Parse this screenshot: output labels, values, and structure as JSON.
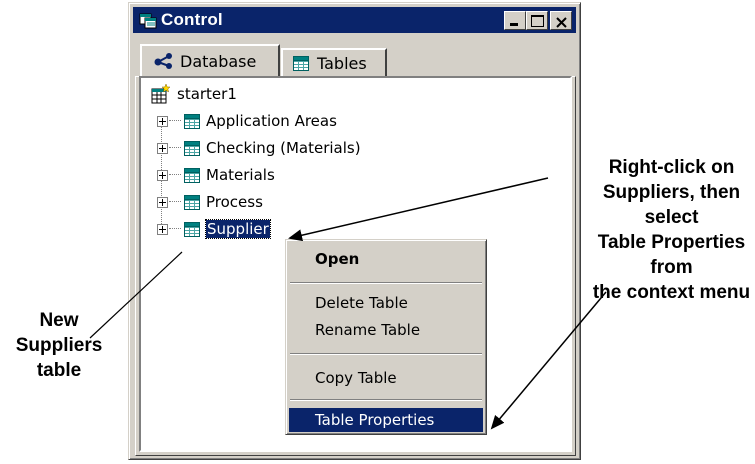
{
  "window": {
    "title": "Control",
    "title_icon": "control-window-icon"
  },
  "tabs": [
    {
      "label": "Database",
      "icon": "database-connection-icon",
      "selected": true
    },
    {
      "label": "Tables",
      "icon": "table-icon",
      "selected": false
    }
  ],
  "tree": {
    "root": {
      "label": "starter1",
      "icon": "new-database-icon"
    },
    "items": [
      {
        "label": "Application Areas",
        "icon": "table-icon"
      },
      {
        "label": "Checking (Materials)",
        "icon": "table-icon"
      },
      {
        "label": "Materials",
        "icon": "table-icon"
      },
      {
        "label": "Process",
        "icon": "table-icon"
      },
      {
        "label": "Supplier",
        "icon": "table-icon",
        "selected": true
      }
    ]
  },
  "context_menu": {
    "items": [
      {
        "label": "Open",
        "bold": true
      },
      {
        "label": "Delete Table"
      },
      {
        "label": "Rename Table"
      },
      {
        "label": "Copy Table"
      },
      {
        "label": "Table Properties",
        "highlighted": true
      }
    ]
  },
  "annotations": {
    "right_callout": "Right-click on\nSuppliers, then select\nTable Properties from\nthe context menu",
    "left_callout": "New\nSuppliers\ntable"
  },
  "colors": {
    "titlebar": "#0a246a",
    "face": "#d4d0c8",
    "selection": "#0a246a",
    "table_icon": "#008080"
  }
}
